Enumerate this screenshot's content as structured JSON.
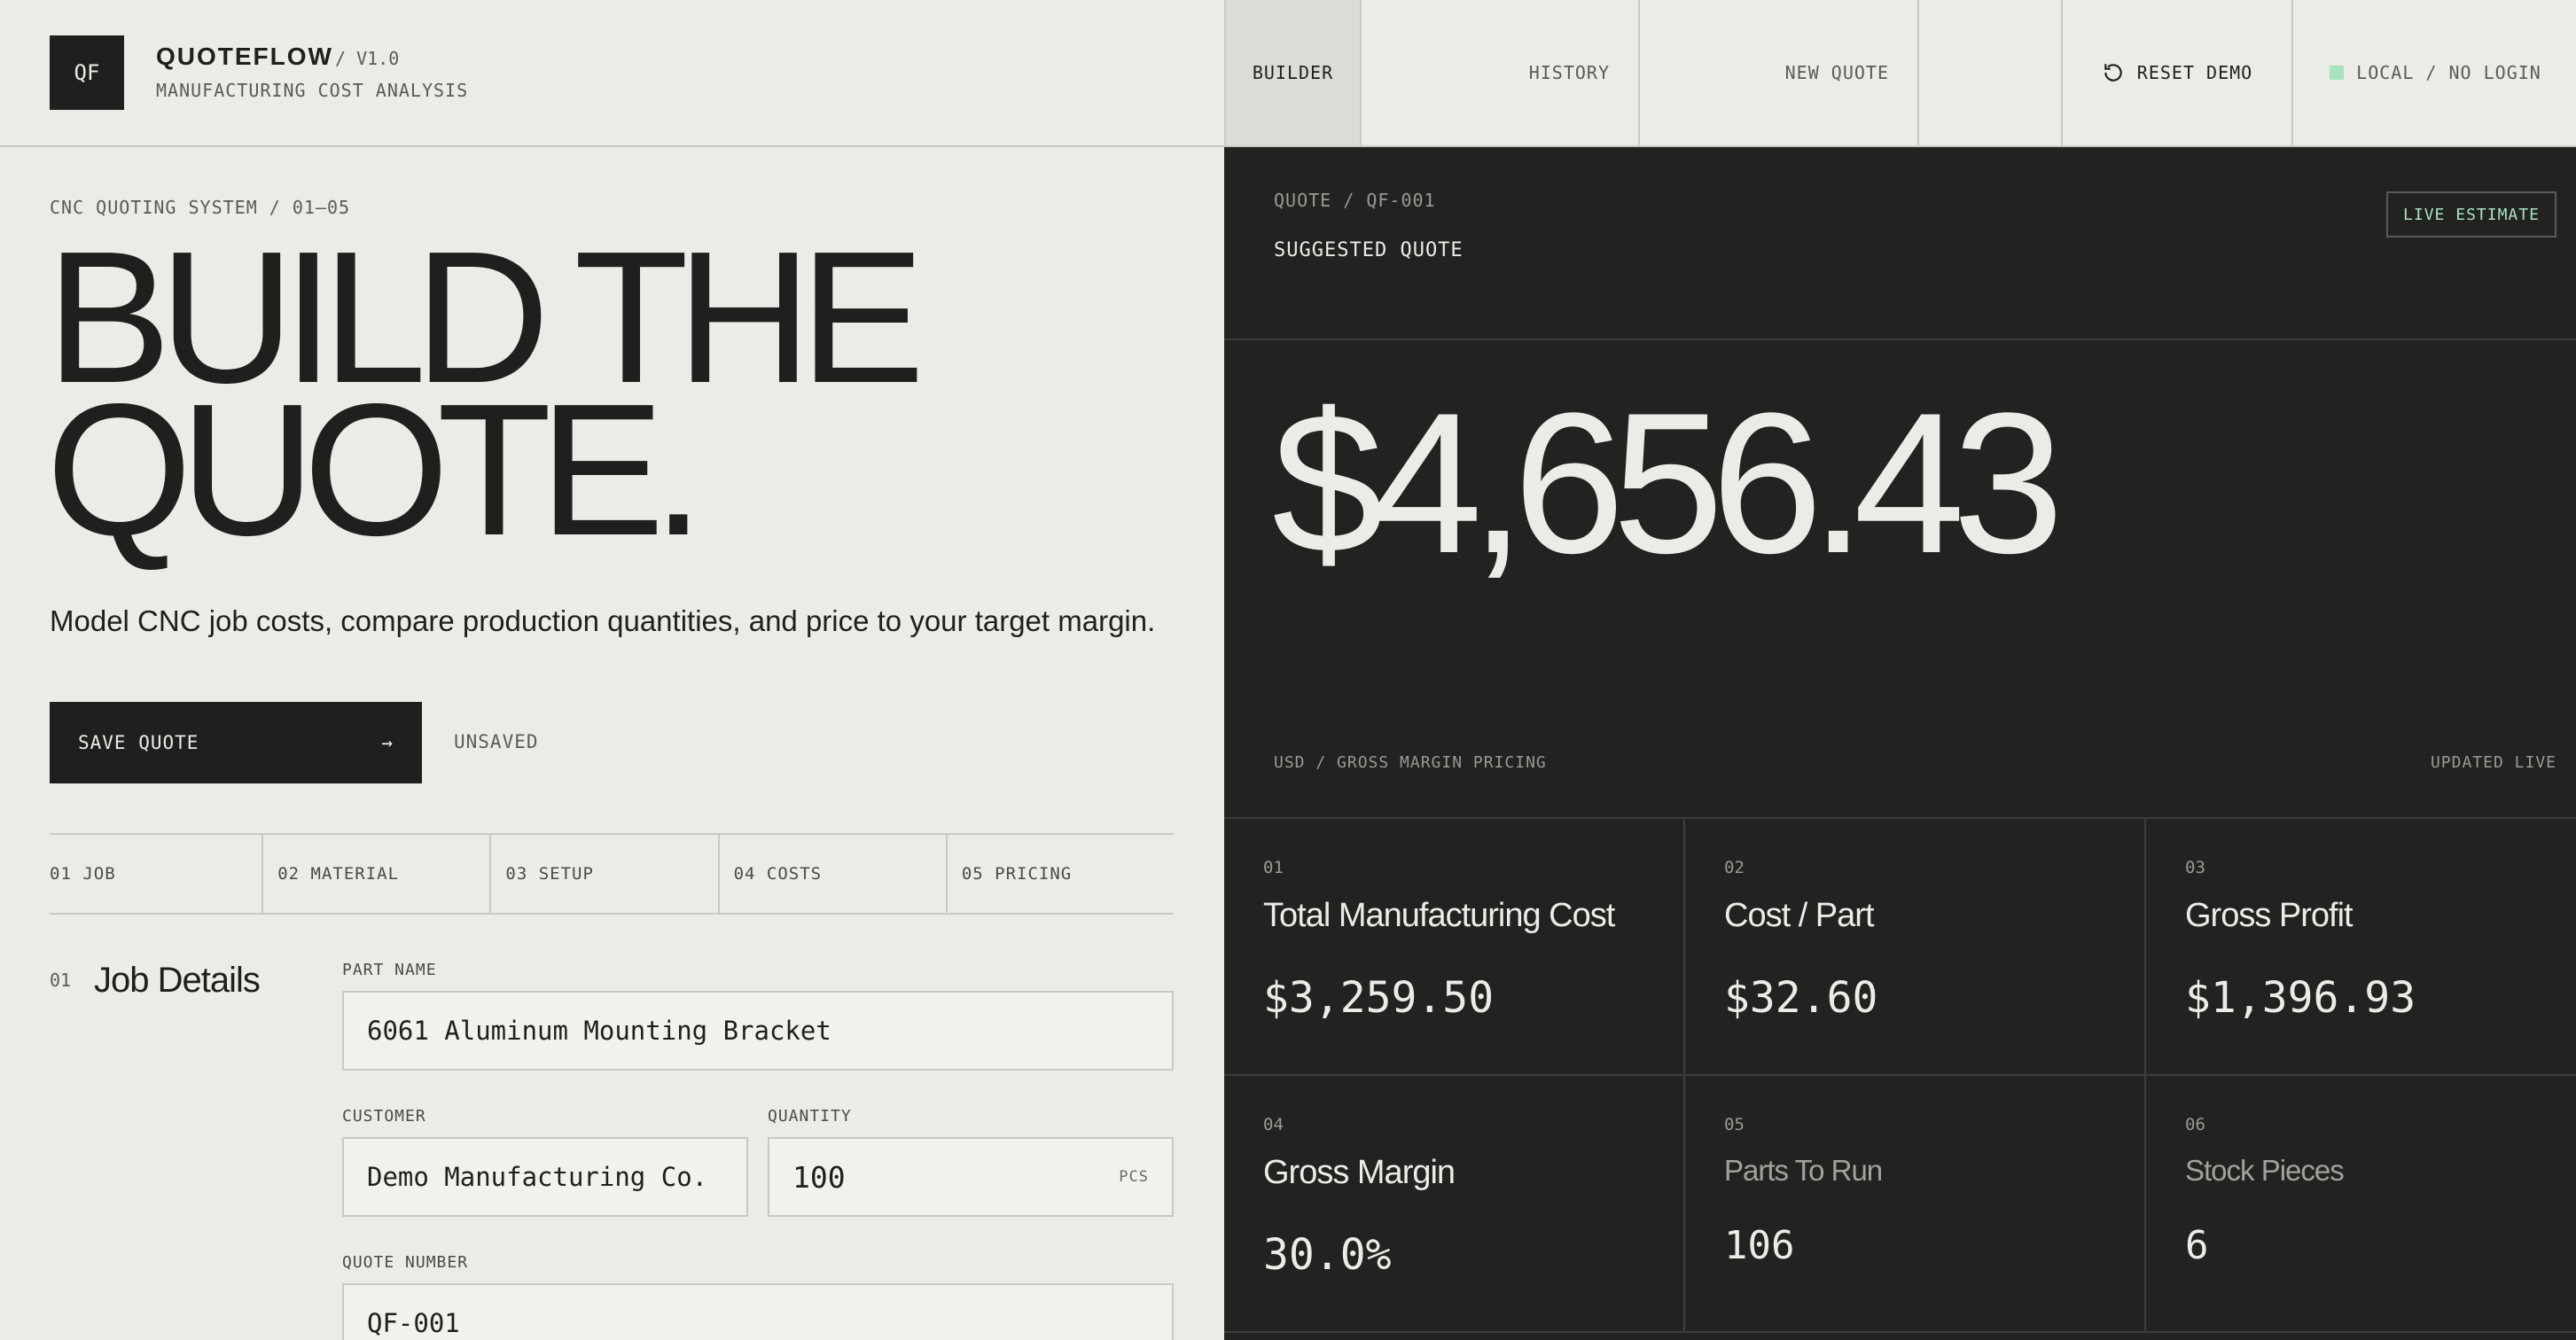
{
  "brand": {
    "logo": "QF",
    "name": "QUOTEFLOW",
    "version": "/ V1.0",
    "subtitle": "MANUFACTURING COST ANALYSIS"
  },
  "nav": {
    "builder": "BUILDER",
    "history": "HISTORY",
    "new_quote": "NEW QUOTE",
    "reset_demo": "RESET DEMO",
    "reset_icon": "refresh-icon",
    "status": "LOCAL / NO LOGIN",
    "status_color": "#a8e3bf"
  },
  "hero": {
    "breadcrumb": "CNC QUOTING SYSTEM / 01–05",
    "headline_line1": "BUILD THE",
    "headline_line2": "QUOTE.",
    "subtitle": "Model CNC job costs, compare production quantities, and price to your target margin.",
    "save_label": "SAVE QUOTE",
    "save_arrow": "→",
    "save_status": "UNSAVED"
  },
  "steps": [
    {
      "label": "01 JOB"
    },
    {
      "label": "02 MATERIAL"
    },
    {
      "label": "03 SETUP"
    },
    {
      "label": "04 COSTS"
    },
    {
      "label": "05 PRICING"
    }
  ],
  "job": {
    "section_num": "01",
    "section_title": "Job Details",
    "part_name_label": "PART NAME",
    "part_name": "6061 Aluminum Mounting Bracket",
    "customer_label": "CUSTOMER",
    "customer": "Demo Manufacturing Co.",
    "quantity_label": "QUANTITY",
    "quantity": "100",
    "quantity_unit": "PCS",
    "quote_number_label": "QUOTE NUMBER",
    "quote_number": "QF-001"
  },
  "quote": {
    "label": "QUOTE / QF-001",
    "suggested": "SUGGESTED QUOTE",
    "badge": "LIVE ESTIMATE",
    "price": "$4,656.43",
    "footer_left": "USD / GROSS MARGIN PRICING",
    "footer_right": "UPDATED LIVE"
  },
  "metrics": [
    {
      "num": "01",
      "title": "Total Manufacturing Cost",
      "value": "$3,259.50"
    },
    {
      "num": "02",
      "title": "Cost / Part",
      "value": "$32.60"
    },
    {
      "num": "03",
      "title": "Gross Profit",
      "value": "$1,396.93"
    },
    {
      "num": "04",
      "title": "Gross Margin",
      "value": "30.0%"
    },
    {
      "num": "05",
      "title": "Parts To Run",
      "value": "106"
    },
    {
      "num": "06",
      "title": "Stock Pieces",
      "value": "6"
    }
  ]
}
